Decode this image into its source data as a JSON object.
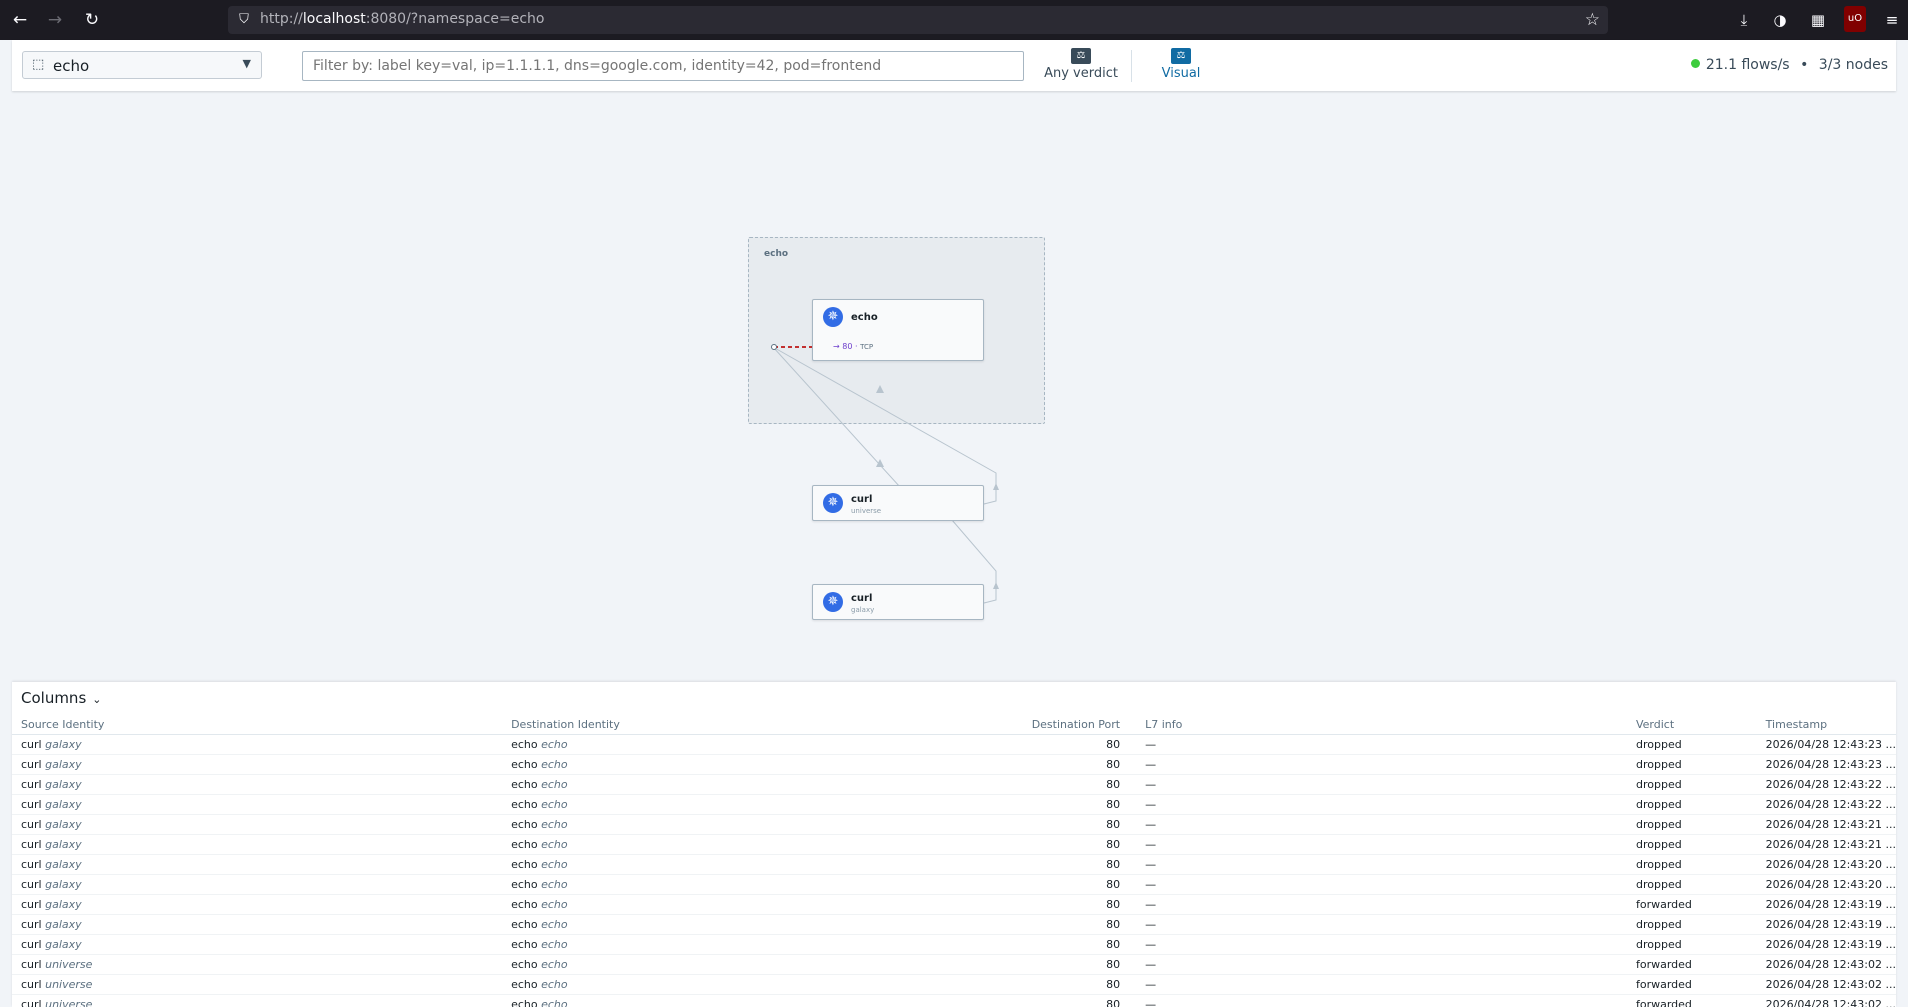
{
  "browser": {
    "url_prefix": "http://",
    "url_host": "localhost",
    "url_rest": ":8080/?namespace=echo"
  },
  "topbar": {
    "namespace": "echo",
    "filter_placeholder": "Filter by: label key=val, ip=1.1.1.1, dns=google.com, identity=42, pod=frontend",
    "verdict_label": "Any verdict",
    "visual_label": "Visual",
    "flows_rate": "21.1 flows/s",
    "separator": "•",
    "nodes": "3/3 nodes",
    "accent": "#106ba3",
    "status_color": "#3dcc3d"
  },
  "map": {
    "namespace_box_label": "echo",
    "cards": [
      {
        "name": "echo",
        "sub": "",
        "port": "80",
        "protocol": "TCP"
      },
      {
        "name": "curl",
        "sub": "universe"
      },
      {
        "name": "curl",
        "sub": "galaxy"
      }
    ]
  },
  "table": {
    "columns_label": "Columns",
    "headers": {
      "source": "Source Identity",
      "destination": "Destination Identity",
      "port": "Destination Port",
      "l7": "L7 info",
      "verdict": "Verdict",
      "timestamp": "Timestamp"
    },
    "rows": [
      {
        "src": "curl",
        "src_ns": "galaxy",
        "dst": "echo",
        "dst_ns": "echo",
        "port": "80",
        "l7": "—",
        "verdict": "dropped",
        "ts": "2026/04/28 12:43:23 ..."
      },
      {
        "src": "curl",
        "src_ns": "galaxy",
        "dst": "echo",
        "dst_ns": "echo",
        "port": "80",
        "l7": "—",
        "verdict": "dropped",
        "ts": "2026/04/28 12:43:23 ..."
      },
      {
        "src": "curl",
        "src_ns": "galaxy",
        "dst": "echo",
        "dst_ns": "echo",
        "port": "80",
        "l7": "—",
        "verdict": "dropped",
        "ts": "2026/04/28 12:43:22 ..."
      },
      {
        "src": "curl",
        "src_ns": "galaxy",
        "dst": "echo",
        "dst_ns": "echo",
        "port": "80",
        "l7": "—",
        "verdict": "dropped",
        "ts": "2026/04/28 12:43:22 ..."
      },
      {
        "src": "curl",
        "src_ns": "galaxy",
        "dst": "echo",
        "dst_ns": "echo",
        "port": "80",
        "l7": "—",
        "verdict": "dropped",
        "ts": "2026/04/28 12:43:21 ..."
      },
      {
        "src": "curl",
        "src_ns": "galaxy",
        "dst": "echo",
        "dst_ns": "echo",
        "port": "80",
        "l7": "—",
        "verdict": "dropped",
        "ts": "2026/04/28 12:43:21 ..."
      },
      {
        "src": "curl",
        "src_ns": "galaxy",
        "dst": "echo",
        "dst_ns": "echo",
        "port": "80",
        "l7": "—",
        "verdict": "dropped",
        "ts": "2026/04/28 12:43:20 ..."
      },
      {
        "src": "curl",
        "src_ns": "galaxy",
        "dst": "echo",
        "dst_ns": "echo",
        "port": "80",
        "l7": "—",
        "verdict": "dropped",
        "ts": "2026/04/28 12:43:20 ..."
      },
      {
        "src": "curl",
        "src_ns": "galaxy",
        "dst": "echo",
        "dst_ns": "echo",
        "port": "80",
        "l7": "—",
        "verdict": "forwarded",
        "ts": "2026/04/28 12:43:19 ..."
      },
      {
        "src": "curl",
        "src_ns": "galaxy",
        "dst": "echo",
        "dst_ns": "echo",
        "port": "80",
        "l7": "—",
        "verdict": "dropped",
        "ts": "2026/04/28 12:43:19 ..."
      },
      {
        "src": "curl",
        "src_ns": "galaxy",
        "dst": "echo",
        "dst_ns": "echo",
        "port": "80",
        "l7": "—",
        "verdict": "dropped",
        "ts": "2026/04/28 12:43:19 ..."
      },
      {
        "src": "curl",
        "src_ns": "universe",
        "dst": "echo",
        "dst_ns": "echo",
        "port": "80",
        "l7": "—",
        "verdict": "forwarded",
        "ts": "2026/04/28 12:43:02 ..."
      },
      {
        "src": "curl",
        "src_ns": "universe",
        "dst": "echo",
        "dst_ns": "echo",
        "port": "80",
        "l7": "—",
        "verdict": "forwarded",
        "ts": "2026/04/28 12:43:02 ..."
      },
      {
        "src": "curl",
        "src_ns": "universe",
        "dst": "echo",
        "dst_ns": "echo",
        "port": "80",
        "l7": "—",
        "verdict": "forwarded",
        "ts": "2026/04/28 12:43:02 ..."
      }
    ]
  }
}
